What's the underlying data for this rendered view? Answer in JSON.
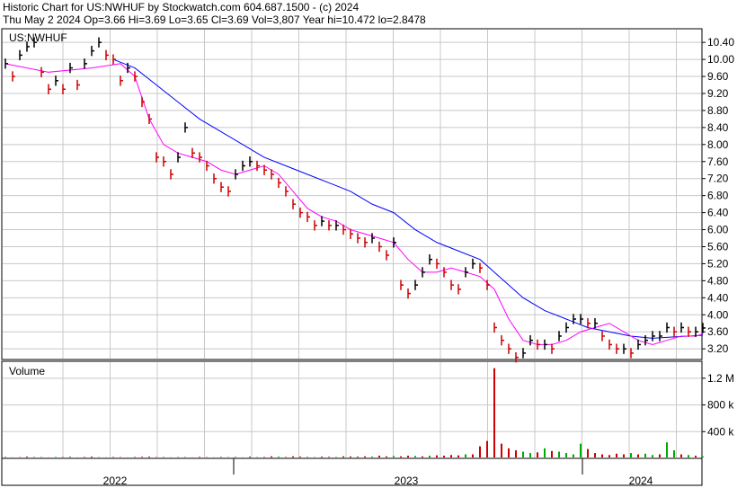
{
  "header": {
    "line1": "Historic Chart for US:NWHUF by Stockwatch.com 604.687.1500 - (c) 2024",
    "line2": "Thu May  2 2024  Op=3.66  Hi=3.69  Lo=3.65  Cl=3.69  Vol=3,807  Year hi=10.472  lo=2.8478"
  },
  "colors": {
    "bar_up": "#000000",
    "bar_down": "#cc0000",
    "ma_short": "#ff00ff",
    "ma_long": "#0000ff",
    "vol_up": "#00aa00",
    "vol_down": "#cc0000",
    "grid": "#c8c8c8"
  },
  "chart_data": [
    {
      "type": "line",
      "title": "US:NWHUF",
      "ylim": [
        2.95,
        10.72
      ],
      "y_ticks": [
        "10.40",
        "10.00",
        "9.60",
        "9.20",
        "8.80",
        "8.40",
        "8.00",
        "7.60",
        "7.20",
        "6.80",
        "6.40",
        "6.00",
        "5.60",
        "5.20",
        "4.80",
        "4.40",
        "4.00",
        "3.60",
        "3.20"
      ],
      "x_labels": [
        "2022",
        "2023",
        "2024"
      ],
      "grid": true,
      "series": [
        {
          "style": "ohlc",
          "x": [
            0,
            8,
            16,
            24,
            32,
            40,
            48,
            56,
            64,
            72,
            80,
            88,
            96,
            104,
            112,
            120,
            128,
            136,
            144,
            152,
            160,
            168,
            176,
            184,
            192,
            200,
            208,
            216,
            224,
            232,
            240,
            248,
            256,
            264,
            272,
            280,
            288,
            296,
            304,
            312,
            320,
            328,
            336,
            344,
            352,
            360,
            368,
            376,
            384,
            392,
            400,
            408,
            416,
            424,
            432,
            440,
            448,
            456,
            464,
            472,
            480,
            488,
            496,
            504,
            512,
            520,
            528,
            536,
            544,
            552,
            560,
            568,
            576,
            584,
            592,
            600,
            608,
            616,
            624,
            632,
            640,
            648,
            656,
            664,
            672,
            680,
            688,
            696,
            704,
            712,
            720,
            728,
            736,
            744,
            752,
            760,
            768,
            776
          ],
          "values": [
            9.9,
            9.6,
            10.1,
            10.3,
            10.4,
            9.7,
            9.3,
            9.5,
            9.3,
            9.8,
            9.4,
            9.9,
            10.2,
            10.4,
            10.1,
            10.0,
            9.5,
            9.8,
            9.6,
            9.0,
            8.6,
            7.7,
            7.6,
            7.3,
            7.7,
            8.4,
            7.8,
            7.7,
            7.5,
            7.2,
            7.0,
            6.9,
            7.3,
            7.5,
            7.6,
            7.5,
            7.4,
            7.3,
            7.1,
            6.9,
            6.6,
            6.4,
            6.3,
            6.1,
            6.2,
            6.1,
            6.1,
            6.0,
            5.9,
            5.8,
            5.7,
            5.8,
            5.6,
            5.4,
            5.7,
            4.7,
            4.5,
            4.7,
            5.0,
            5.3,
            5.2,
            5.0,
            4.7,
            4.6,
            5.0,
            5.2,
            5.1,
            4.7,
            3.7,
            3.4,
            3.2,
            3.0,
            3.1,
            3.4,
            3.3,
            3.3,
            3.2,
            3.5,
            3.7,
            3.9,
            3.9,
            3.8,
            3.8,
            3.5,
            3.3,
            3.2,
            3.2,
            3.1,
            3.3,
            3.4,
            3.5,
            3.5,
            3.7,
            3.6,
            3.7,
            3.6,
            3.6,
            3.69
          ]
        },
        {
          "name": "",
          "style": "ma_short",
          "x": [
            0,
            48,
            96,
            128,
            144,
            160,
            176,
            192,
            208,
            224,
            240,
            256,
            272,
            288,
            304,
            320,
            336,
            352,
            368,
            384,
            400,
            416,
            432,
            448,
            464,
            480,
            496,
            512,
            528,
            544,
            560,
            576,
            592,
            608,
            624,
            640,
            656,
            672,
            688,
            704,
            720,
            736,
            752,
            768,
            776
          ],
          "values": [
            9.9,
            9.7,
            9.8,
            9.9,
            9.6,
            8.6,
            8.0,
            7.8,
            7.7,
            7.6,
            7.4,
            7.3,
            7.4,
            7.5,
            7.3,
            6.9,
            6.5,
            6.3,
            6.2,
            6.0,
            5.9,
            5.8,
            5.7,
            5.3,
            5.0,
            5.0,
            5.1,
            5.0,
            4.9,
            4.6,
            3.9,
            3.4,
            3.3,
            3.3,
            3.4,
            3.6,
            3.7,
            3.8,
            3.6,
            3.4,
            3.3,
            3.4,
            3.5,
            3.5,
            3.55
          ]
        },
        {
          "name": "",
          "style": "ma_long",
          "x": [
            120,
            144,
            168,
            192,
            216,
            240,
            264,
            288,
            312,
            336,
            360,
            384,
            408,
            432,
            456,
            480,
            504,
            528,
            544,
            560,
            576,
            600,
            624,
            648,
            672,
            696,
            720,
            744,
            760,
            776
          ],
          "values": [
            10.0,
            9.8,
            9.4,
            9.0,
            8.6,
            8.3,
            8.0,
            7.7,
            7.5,
            7.3,
            7.1,
            6.9,
            6.6,
            6.4,
            6.0,
            5.7,
            5.5,
            5.3,
            5.0,
            4.7,
            4.4,
            4.1,
            3.9,
            3.7,
            3.6,
            3.5,
            3.45,
            3.48,
            3.5,
            3.52
          ]
        }
      ]
    },
    {
      "type": "bar",
      "title": "Volume",
      "ylim": [
        0,
        1400000
      ],
      "y_ticks": [
        "1.2 M",
        "800 k",
        "400 k"
      ],
      "categories": [
        0,
        8,
        16,
        24,
        32,
        40,
        48,
        56,
        64,
        72,
        80,
        88,
        96,
        104,
        112,
        120,
        128,
        136,
        144,
        152,
        160,
        168,
        176,
        184,
        192,
        200,
        208,
        216,
        224,
        232,
        240,
        248,
        256,
        264,
        272,
        280,
        288,
        296,
        304,
        312,
        320,
        328,
        336,
        344,
        352,
        360,
        368,
        376,
        384,
        392,
        400,
        408,
        416,
        424,
        432,
        440,
        448,
        456,
        464,
        472,
        480,
        488,
        496,
        504,
        512,
        520,
        528,
        536,
        544,
        552,
        560,
        568,
        576,
        584,
        592,
        600,
        608,
        616,
        624,
        632,
        640,
        648,
        656,
        664,
        672,
        680,
        688,
        696,
        704,
        712,
        720,
        728,
        736,
        744,
        752,
        760,
        768,
        776
      ],
      "values": [
        20000,
        15000,
        18000,
        25000,
        20000,
        18000,
        15000,
        20000,
        18000,
        22000,
        15000,
        20000,
        25000,
        18000,
        15000,
        20000,
        18000,
        15000,
        20000,
        22000,
        25000,
        18000,
        20000,
        15000,
        18000,
        20000,
        15000,
        22000,
        18000,
        15000,
        20000,
        18000,
        20000,
        15000,
        25000,
        18000,
        20000,
        30000,
        25000,
        20000,
        30000,
        25000,
        20000,
        18000,
        25000,
        22000,
        20000,
        30000,
        28000,
        25000,
        30000,
        25000,
        40000,
        30000,
        35000,
        30000,
        40000,
        35000,
        30000,
        40000,
        45000,
        40000,
        50000,
        45000,
        60000,
        60000,
        180000,
        260000,
        1350000,
        220000,
        150000,
        120000,
        100000,
        80000,
        90000,
        150000,
        110000,
        100000,
        80000,
        60000,
        220000,
        140000,
        80000,
        60000,
        50000,
        70000,
        60000,
        80000,
        60000,
        70000,
        50000,
        60000,
        240000,
        120000,
        60000,
        50000,
        40000,
        30000
      ],
      "up": [
        0,
        1,
        0,
        0,
        1,
        0,
        0,
        1,
        0,
        0,
        1,
        0,
        0,
        1,
        0,
        0,
        0,
        1,
        0,
        0,
        0,
        0,
        1,
        0,
        0,
        1,
        0,
        0,
        0,
        0,
        0,
        1,
        0,
        1,
        0,
        1,
        0,
        0,
        1,
        0,
        0,
        0,
        0,
        1,
        0,
        0,
        1,
        0,
        0,
        0,
        0,
        1,
        0,
        0,
        1,
        0,
        0,
        1,
        0,
        1,
        0,
        0,
        0,
        0,
        1,
        0,
        0,
        0,
        0,
        0,
        0,
        0,
        1,
        1,
        0,
        1,
        0,
        1,
        1,
        1,
        1,
        0,
        0,
        0,
        0,
        0,
        0,
        1,
        0,
        1,
        1,
        0,
        1,
        1,
        0,
        1,
        0,
        1
      ]
    }
  ]
}
